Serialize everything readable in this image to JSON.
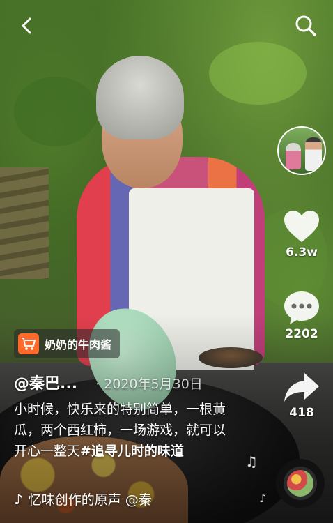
{
  "top_bar": {
    "back_icon": "chevron-left-icon",
    "search_icon": "search-icon"
  },
  "product": {
    "icon": "shopping-cart-icon",
    "label": "奶奶的牛肉酱",
    "accent": "#ff6a2a"
  },
  "post": {
    "author": "@秦巴...",
    "date": "· 2020年5月30日",
    "caption_text": "小时候，快乐来的特别简单，一根黄瓜，两个西红柿，一场游戏，就可以开心一整天",
    "caption_tag": "#追寻儿时的味道"
  },
  "music": {
    "icon": "tiktok-note-icon",
    "text": "忆味创作的原声    @秦"
  },
  "rail": {
    "likes": "6.3w",
    "comments": "2202",
    "shares": "418"
  }
}
